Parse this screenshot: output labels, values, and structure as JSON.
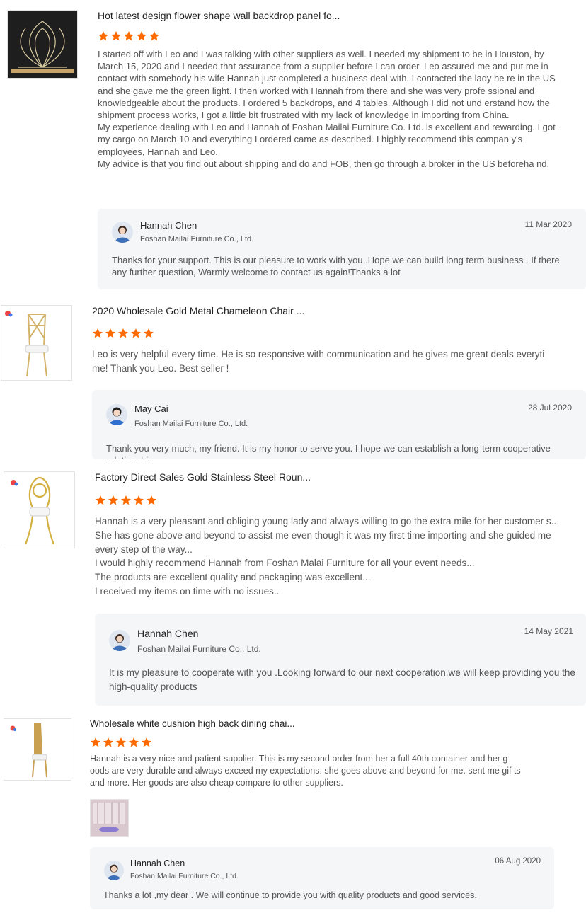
{
  "colors": {
    "star": "#ff6a00",
    "reply_bg": "#f5f6f8"
  },
  "reviews": [
    {
      "title": "Hot latest design flower shape wall backdrop panel fo...",
      "rating": 5,
      "paragraphs": [
        "I started off with Leo and I was talking with other suppliers as well. I needed my shipment to be in Houston, by March 15, 2020 and I needed that assurance from a supplier before I can order. Leo assured me and put me in contact with somebody his wife Hannah just completed a business deal with. I contacted the lady he re in the US and she gave me the green light. I then worked with Hannah from there and she was very profe ssional and knowledgeable about the products. I ordered 5 backdrops, and 4 tables. Although I did not und erstand how the shipment process works, I got a little bit frustrated with my lack of knowledge in importing from China.",
        "My experience dealing with Leo and Hannah of Foshan Mailai Furniture Co. Ltd. is excellent and rewarding. I got my cargo on March 10 and everything I ordered came as described. I highly recommend this compan y's employees, Hannah and Leo.",
        "My advice is that you find out about shipping  and do and FOB, then go through a broker in the US beforeha nd."
      ],
      "reply": {
        "name": "Hannah Chen",
        "company": "Foshan Mailai Furniture Co., Ltd.",
        "date": "11 Mar 2020",
        "text": "Thanks for your support. This is our pleasure to work with you .Hope we can build long term business . If there any further question, Warmly welcome to contact us again!Thanks a lot"
      }
    },
    {
      "title": "2020 Wholesale Gold Metal Chameleon Chair ...",
      "rating": 5,
      "paragraphs": [
        "Leo is very helpful every time. He is so responsive with communication and he gives me great deals everyti me! Thank you Leo. Best seller !"
      ],
      "reply": {
        "name": "May Cai",
        "company": "Foshan Mailai Furniture Co., Ltd.",
        "date": "28 Jul 2020",
        "text": "Thank you very much, my friend. It is my honor to serve you. I hope we can establish a long-term cooperative relationship."
      }
    },
    {
      "title": "Factory Direct Sales Gold Stainless Steel Roun...",
      "rating": 5,
      "paragraphs": [
        "Hannah is a very pleasant and obliging young lady and always willing to go the extra mile for her customer s.. She has gone above and beyond to assist me even though it was my first time importing and she guided me every step of the way...",
        "I would highly recommend Hannah from Foshan Malai Furniture for all your event needs...",
        "The products are excellent quality and packaging was excellent...",
        "I received my items on time with no issues.."
      ],
      "reply": {
        "name": "Hannah Chen",
        "company": "Foshan Mailai Furniture Co., Ltd.",
        "date": "14 May 2021",
        "text": "It is my pleasure to cooperate with you .Looking forward to our next cooperation.we will keep providing you the high-quality products"
      }
    },
    {
      "title": "Wholesale white cushion high back dining chai...",
      "rating": 5,
      "paragraphs": [
        "Hannah is a very nice and patient supplier. This is my second order from her a full 40th container and her g oods are very durable and always exceed my expectations. she goes above and beyond for me. sent me gif ts and more. Her goods are also cheap compare to other suppliers."
      ],
      "reply": {
        "name": "Hannah Chen",
        "company": "Foshan Mailai Furniture Co., Ltd.",
        "date": "06 Aug 2020",
        "text": "Thanks a lot ,my dear . We will continue to provide you with quality products and good services."
      }
    }
  ]
}
